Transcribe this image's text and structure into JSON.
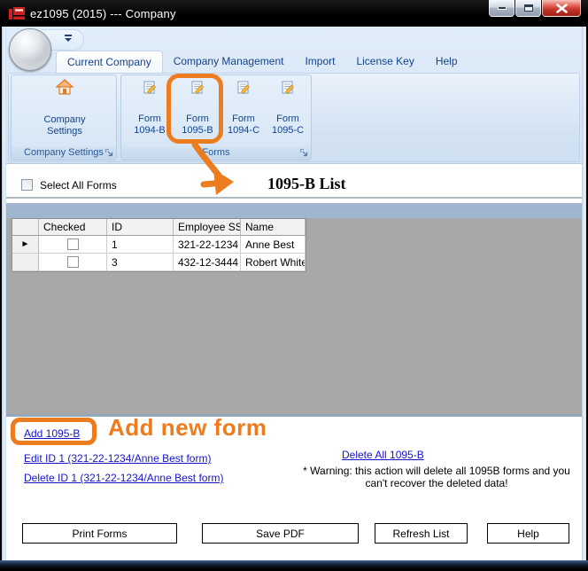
{
  "window": {
    "title": "ez1095 (2015) --- Company"
  },
  "icons": {
    "app": "app-icon",
    "minimize": "minimize-icon",
    "maximize": "maximize-icon",
    "close": "close-icon",
    "close_glyph": "✕",
    "company_settings": "home-icon",
    "form_button": "form-edit-icon",
    "row_selector_glyph": "►",
    "qat": "quick-access-chevron-icon",
    "dialog_launcher": "dialog-launcher-icon"
  },
  "ribbon": {
    "tabs": [
      {
        "label": "Current Company",
        "active": true
      },
      {
        "label": "Company Management",
        "active": false
      },
      {
        "label": "Import",
        "active": false
      },
      {
        "label": "License Key",
        "active": false
      },
      {
        "label": "Help",
        "active": false
      }
    ],
    "company_settings_group": {
      "footer": "Company Settings",
      "button": {
        "line1": "Company",
        "line2": "Settings"
      }
    },
    "forms_group": {
      "footer": "Forms",
      "buttons": [
        {
          "line1": "Form",
          "line2": "1094-B",
          "highlighted": false
        },
        {
          "line1": "Form",
          "line2": "1095-B",
          "highlighted": true
        },
        {
          "line1": "Form",
          "line2": "1094-C",
          "highlighted": false
        },
        {
          "line1": "Form",
          "line2": "1095-C",
          "highlighted": false
        }
      ]
    }
  },
  "list_panel": {
    "select_all_label": "Select All Forms",
    "select_all_checked": false,
    "title": "1095-B List"
  },
  "grid": {
    "columns": [
      "Checked",
      "ID",
      "Employee SS",
      "Name"
    ],
    "rows": [
      {
        "selected": true,
        "checked": false,
        "id": "1",
        "employee_ss": "321-22-1234",
        "name": "Anne Best"
      },
      {
        "selected": false,
        "checked": false,
        "id": "3",
        "employee_ss": "432-12-3444",
        "name": "Robert White"
      }
    ]
  },
  "actions": {
    "add_link": "Add 1095-B",
    "edit_link": "Edit ID 1 (321-22-1234/Anne Best form)",
    "delete_link": "Delete ID 1 (321-22-1234/Anne Best form)",
    "delete_all_link": "Delete All 1095-B",
    "warning_line1": "* Warning: this action will delete all 1095B forms and you",
    "warning_line2": "can't recover the deleted data!"
  },
  "footer_buttons": [
    {
      "label": "Print Forms"
    },
    {
      "label": "Save PDF"
    },
    {
      "label": "Refresh List"
    },
    {
      "label": "Help"
    }
  ],
  "annotations": {
    "add_new_form_label": "Add new form",
    "highlight_color": "#ed7c1f"
  },
  "colors": {
    "accent_orange": "#ed7c1f",
    "link_blue": "#1414cf",
    "ribbon_text_blue": "#15428b",
    "band_blue_gray": "#9fb6ce",
    "panel_gray": "#a8a8a8",
    "close_red": "#c23528"
  }
}
